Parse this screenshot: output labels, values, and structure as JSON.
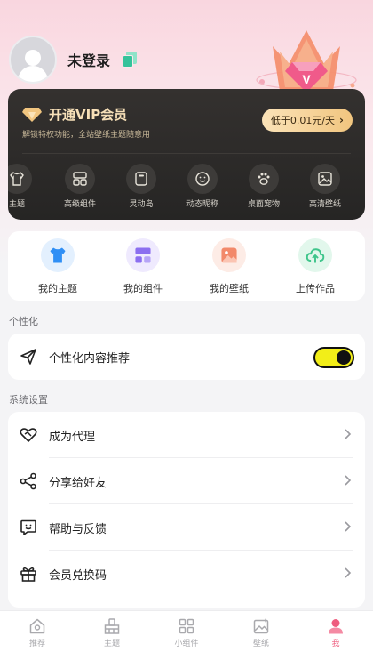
{
  "profile": {
    "name": "未登录"
  },
  "vip": {
    "title": "开通VIP会员",
    "subtitle": "解锁特权功能，全站壁纸主题随意用",
    "price_label": "低于0.01元/天",
    "features": [
      {
        "label": "主题",
        "icon": "shirt-icon"
      },
      {
        "label": "高级组件",
        "icon": "widget-icon"
      },
      {
        "label": "灵动岛",
        "icon": "island-icon"
      },
      {
        "label": "动态昵称",
        "icon": "smile-icon"
      },
      {
        "label": "桌面宠物",
        "icon": "paw-icon"
      },
      {
        "label": "高清壁纸",
        "icon": "image-icon"
      }
    ]
  },
  "quick_actions": [
    {
      "label": "我的主题",
      "icon": "shirt-icon",
      "color": "#2f8ff5"
    },
    {
      "label": "我的组件",
      "icon": "widget-icon",
      "color": "#8b6ef0"
    },
    {
      "label": "我的壁纸",
      "icon": "image-icon",
      "color": "#f2896a"
    },
    {
      "label": "上传作品",
      "icon": "upload-cloud-icon",
      "color": "#3fc58b"
    }
  ],
  "personalization": {
    "section_title": "个性化",
    "recommend_label": "个性化内容推荐",
    "recommend_enabled": true
  },
  "settings": {
    "section_title": "系统设置",
    "items": [
      {
        "label": "成为代理",
        "icon": "handshake-heart-icon"
      },
      {
        "label": "分享给好友",
        "icon": "share-icon"
      },
      {
        "label": "帮助与反馈",
        "icon": "feedback-icon"
      },
      {
        "label": "会员兑换码",
        "icon": "gift-icon"
      }
    ]
  },
  "tabbar": {
    "tabs": [
      {
        "label": "推荐",
        "icon": "home-icon"
      },
      {
        "label": "主题",
        "icon": "brush-icon"
      },
      {
        "label": "小组件",
        "icon": "widget-icon"
      },
      {
        "label": "壁纸",
        "icon": "wallpaper-icon"
      },
      {
        "label": "我",
        "icon": "user-icon"
      }
    ],
    "active_index": 4,
    "active_color": "#ee5c7e"
  }
}
